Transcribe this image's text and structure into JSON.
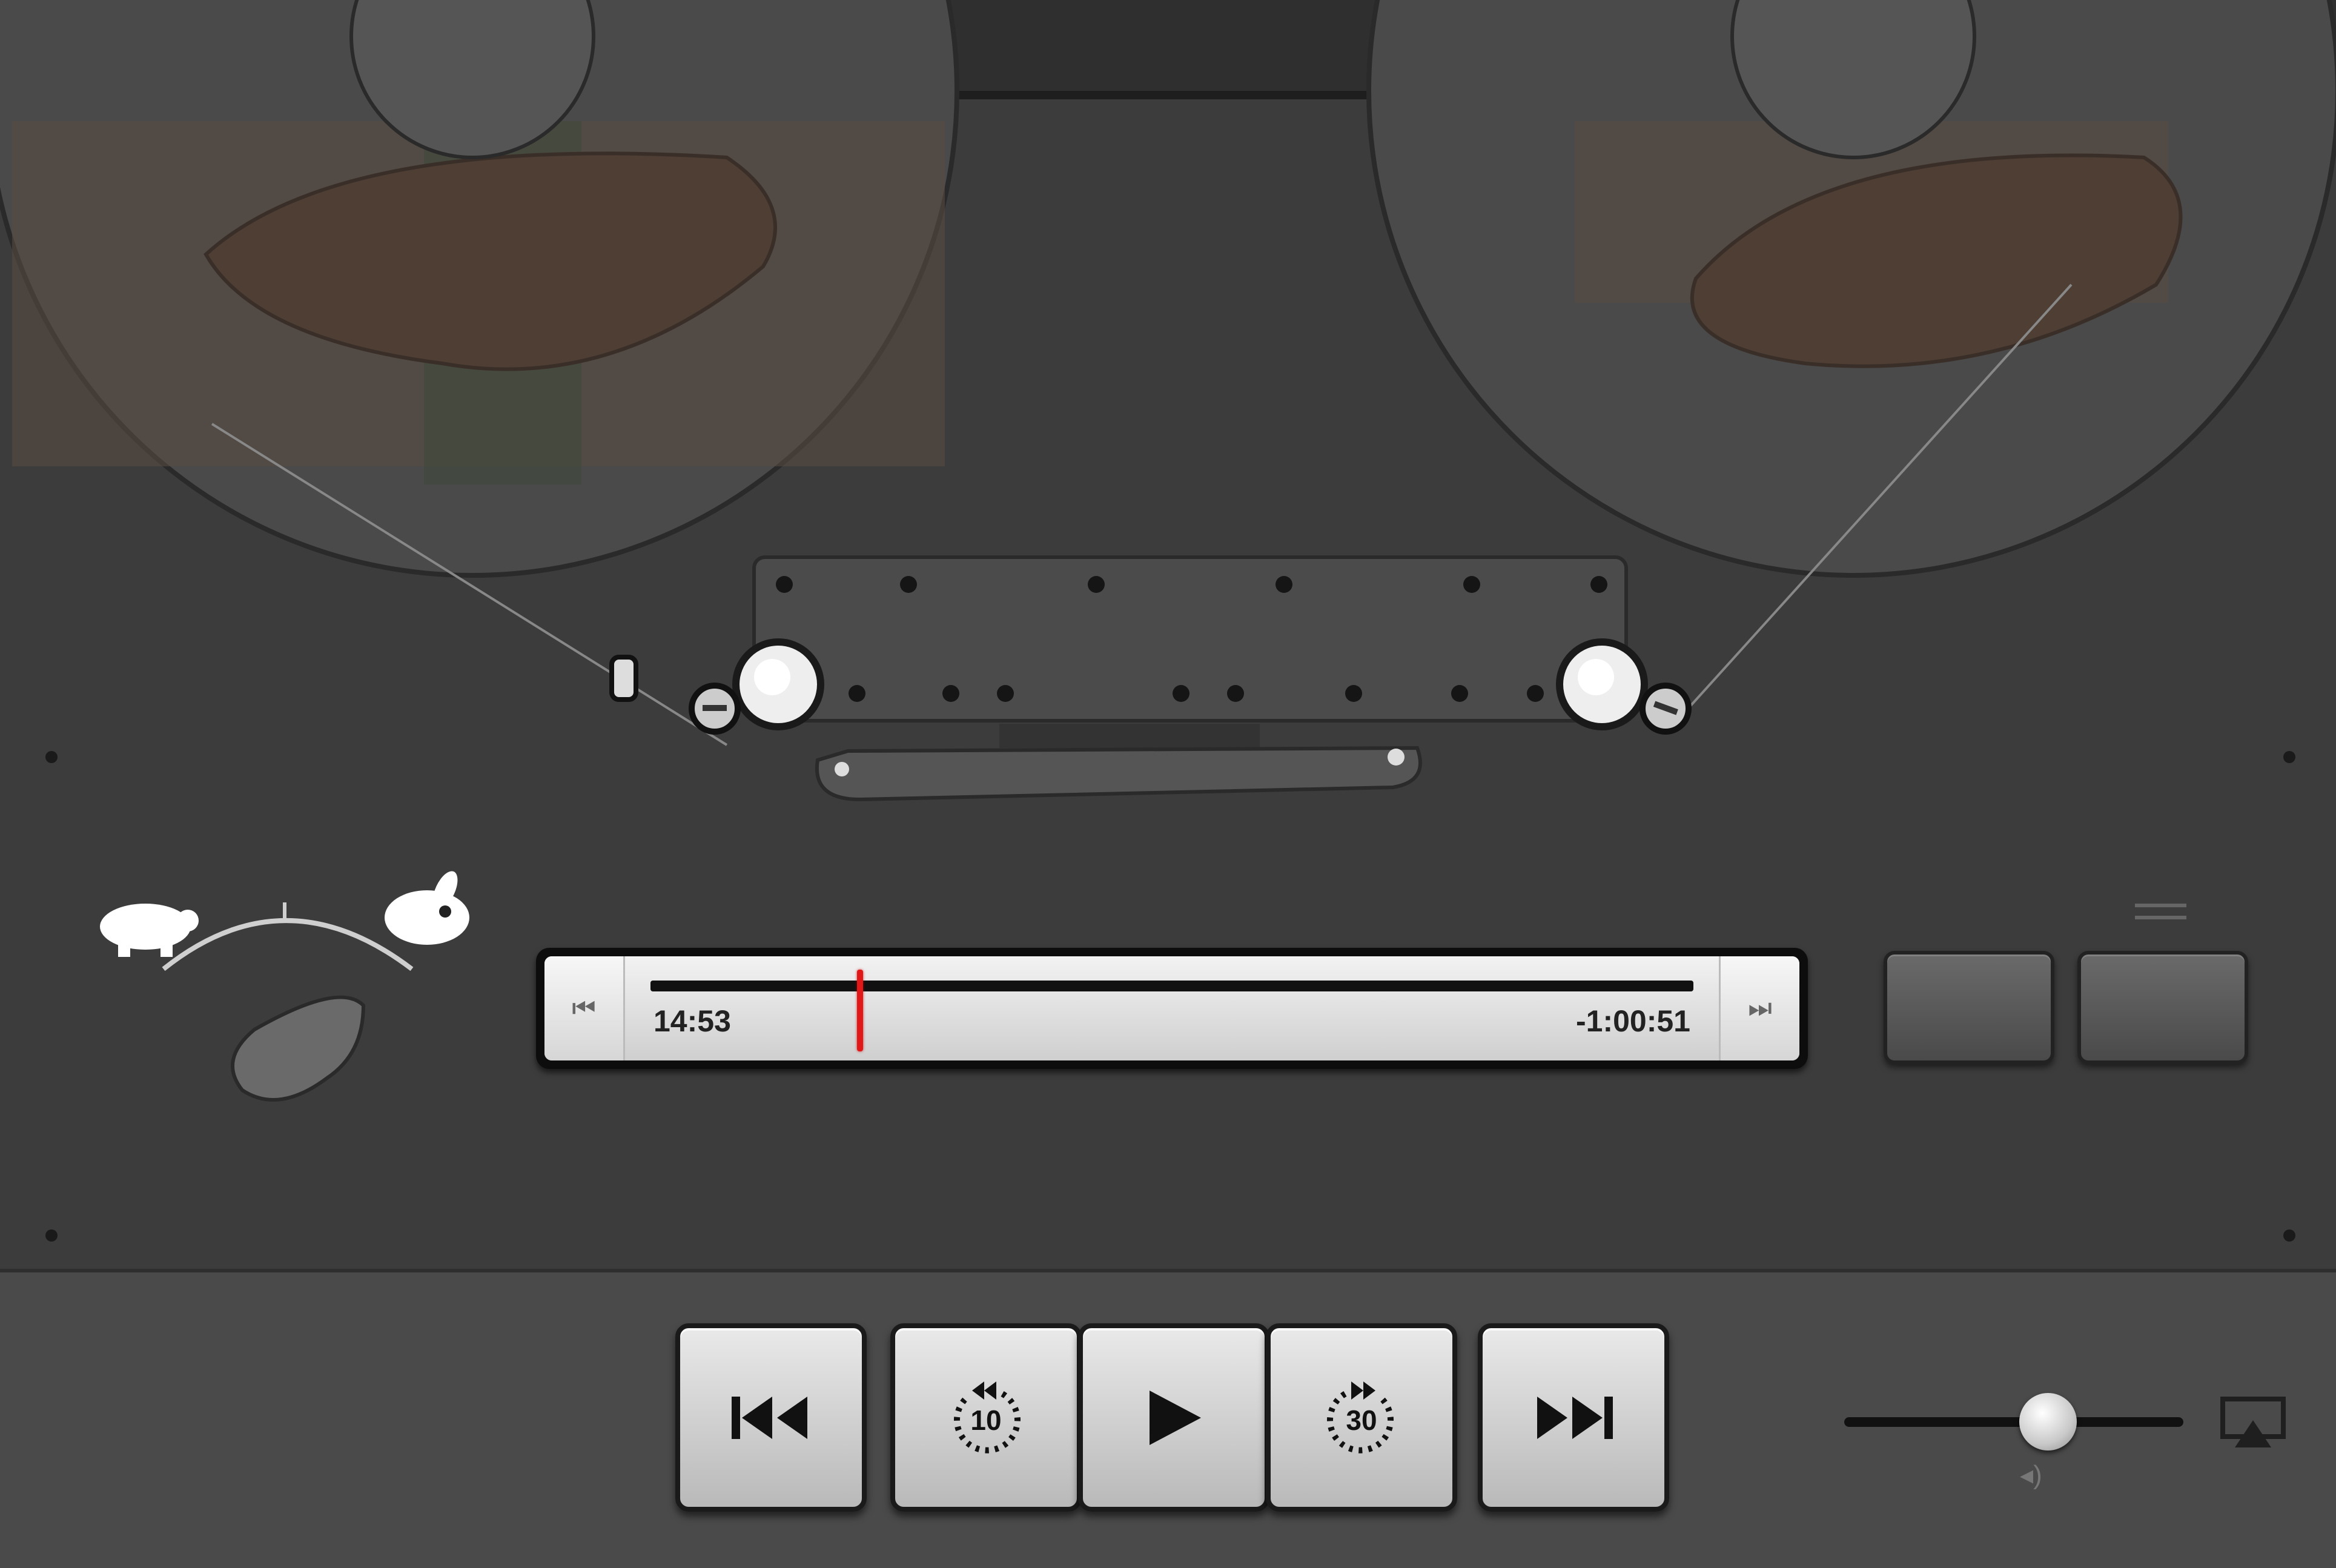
{
  "scrubber": {
    "elapsed": "14:53",
    "remaining": "-1:00:51",
    "progress": 0.198,
    "start_label": "⏮",
    "end_label": "⏭"
  },
  "speed_control": {
    "slow_icon": "turtle-icon",
    "fast_icon": "rabbit-icon",
    "knob_icon": "speed-knob"
  },
  "side_buttons": {
    "share_icon": "share-icon",
    "sleep_icon": "sleep-timer-icon"
  },
  "transport": {
    "previous_icon": "previous-track-icon",
    "skip_back_label": "10",
    "play_icon": "play-icon",
    "skip_forward_label": "30",
    "next_icon": "next-track-icon"
  },
  "volume": {
    "level": 0.6,
    "label": "◂)"
  },
  "airplay_icon": "airplay-icon",
  "colors": {
    "playhead": "#e01818",
    "panel": "#3a3a3a"
  }
}
